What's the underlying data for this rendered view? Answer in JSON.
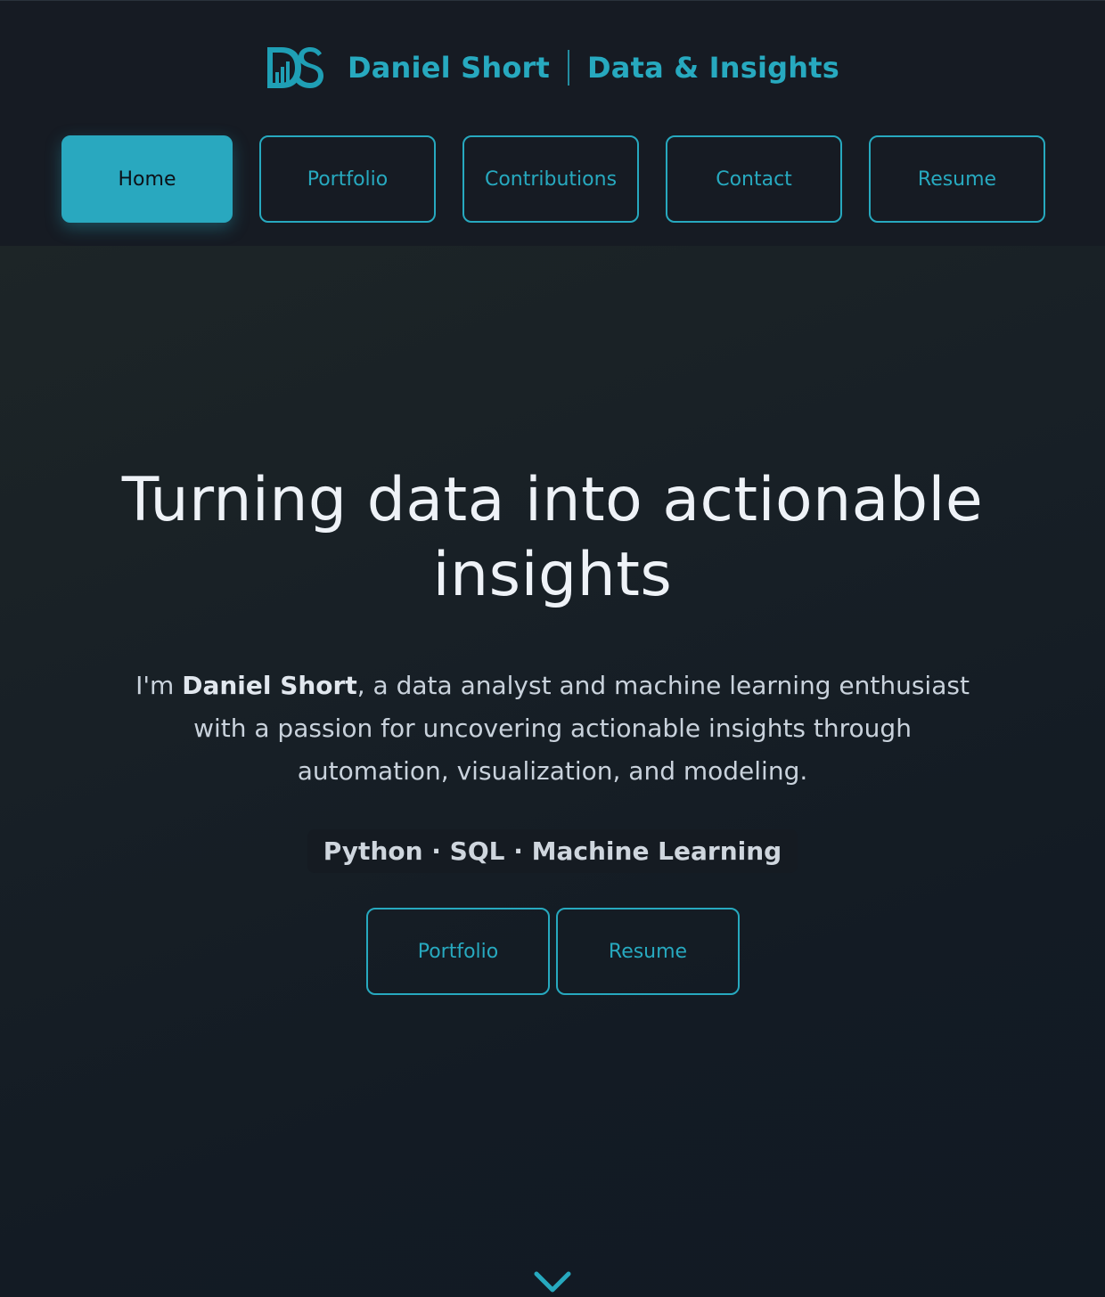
{
  "header": {
    "brand": {
      "logo_text": "DS",
      "name": "Daniel Short",
      "separator": "|",
      "tagline": "Data & Insights"
    },
    "nav": [
      {
        "label": "Home",
        "active": true
      },
      {
        "label": "Portfolio",
        "active": false
      },
      {
        "label": "Contributions",
        "active": false
      },
      {
        "label": "Contact",
        "active": false
      },
      {
        "label": "Resume",
        "active": false
      }
    ]
  },
  "hero": {
    "title": "Turning data into actionable insights",
    "intro_prefix": "I'm ",
    "intro_name": "Daniel Short",
    "intro_rest": ", a data analyst and machine learning enthusiast with a passion for uncovering actionable insights through automation, visualization, and modeling.",
    "skills": "Python · SQL · Machine Learning",
    "buttons": {
      "portfolio": "Portfolio",
      "resume": "Resume"
    },
    "scroll_icon": "chevron-down-icon"
  },
  "colors": {
    "accent": "#27a9bf",
    "header_bg": "#161b23",
    "hero_bg": "#131b24",
    "title_text": "#eef2f7"
  }
}
